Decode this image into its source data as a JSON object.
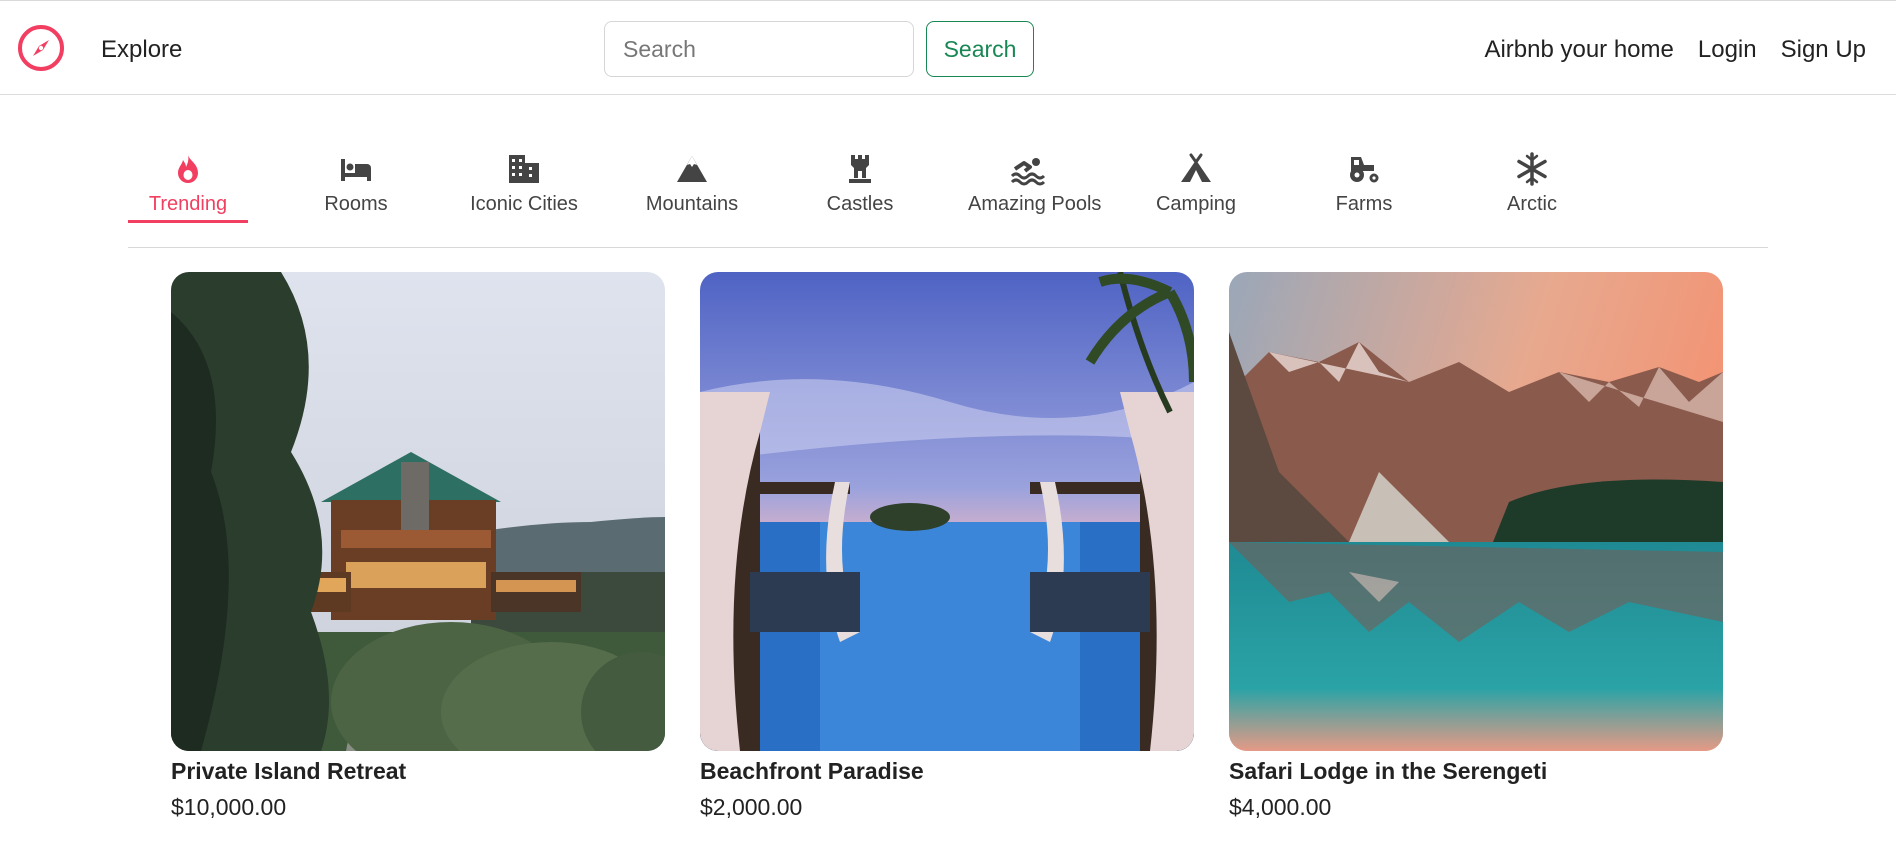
{
  "header": {
    "logo_icon": "compass-icon",
    "brand_color": "#f23f61",
    "explore_label": "Explore",
    "search_placeholder": "Search",
    "search_value": "",
    "search_button_label": "Search",
    "nav_links": [
      "Airbnb your home",
      "Login",
      "Sign Up"
    ]
  },
  "categories": [
    {
      "label": "Trending",
      "icon": "flame-icon",
      "active": true
    },
    {
      "label": "Rooms",
      "icon": "bed-icon",
      "active": false
    },
    {
      "label": "Iconic Cities",
      "icon": "city-icon",
      "active": false
    },
    {
      "label": "Mountains",
      "icon": "mountain-icon",
      "active": false
    },
    {
      "label": "Castles",
      "icon": "castle-icon",
      "active": false
    },
    {
      "label": "Amazing Pools",
      "icon": "swimmer-icon",
      "active": false
    },
    {
      "label": "Camping",
      "icon": "tent-icon",
      "active": false
    },
    {
      "label": "Farms",
      "icon": "tractor-icon",
      "active": false
    },
    {
      "label": "Arctic",
      "icon": "snowflake-icon",
      "active": false
    }
  ],
  "listings": [
    {
      "title": "Private Island Retreat",
      "price": "$10,000.00",
      "image": "lodge-photo"
    },
    {
      "title": "Beachfront Paradise",
      "price": "$2,000.00",
      "image": "infinity-pool-photo"
    },
    {
      "title": "Safari Lodge in the Serengeti",
      "price": "$4,000.00",
      "image": "mountain-lake-photo"
    }
  ],
  "colors": {
    "active": "#f23f61",
    "search_button": "#198754"
  }
}
